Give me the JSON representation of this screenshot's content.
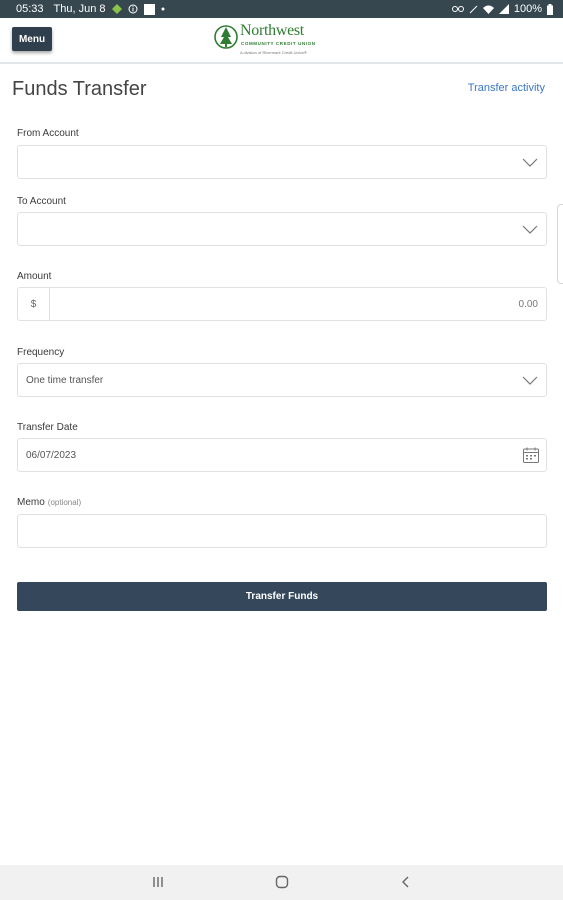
{
  "status_bar": {
    "time": "05:33",
    "date": "Thu, Jun 8",
    "battery": "100%",
    "icons": [
      "android-icon",
      "info-icon",
      "square-icon",
      "dot-icon",
      "link-icon",
      "mute-icon",
      "wifi-icon",
      "signal-icon",
      "battery-icon"
    ]
  },
  "header": {
    "menu_label": "Menu",
    "logo": {
      "name": "Northwest",
      "subtitle": "COMMUNITY CREDIT UNION",
      "tagline": "A division of Rivermark Credit Union®"
    }
  },
  "page": {
    "title": "Funds Transfer",
    "activity_link": "Transfer activity"
  },
  "form": {
    "from_account": {
      "label": "From Account",
      "value": ""
    },
    "to_account": {
      "label": "To Account",
      "value": ""
    },
    "amount": {
      "label": "Amount",
      "currency": "$",
      "value": "0.00"
    },
    "frequency": {
      "label": "Frequency",
      "value": "One time transfer"
    },
    "transfer_date": {
      "label": "Transfer Date",
      "value": "06/07/2023"
    },
    "memo": {
      "label": "Memo",
      "optional": "(optional)",
      "value": ""
    },
    "submit_label": "Transfer Funds"
  },
  "colors": {
    "status_bar": "#37474f",
    "primary_button": "#35475a",
    "link": "#3b78c4",
    "brand_green": "#2e7d32"
  }
}
